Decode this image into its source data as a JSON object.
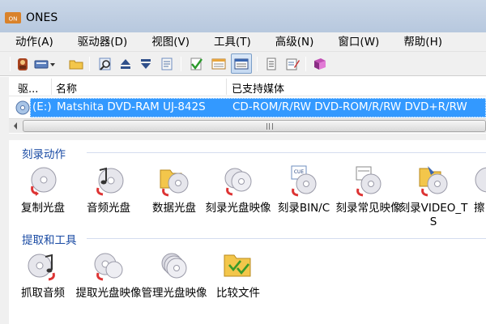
{
  "window": {
    "title": "ONES"
  },
  "menu": [
    {
      "label": "动作(A)"
    },
    {
      "label": "驱动器(D)"
    },
    {
      "label": "视图(V)"
    },
    {
      "label": "工具(T)"
    },
    {
      "label": "高级(N)"
    },
    {
      "label": "窗口(W)"
    },
    {
      "label": "帮助(H)"
    }
  ],
  "toolbar": {
    "icons": [
      "burner-icon",
      "dropdown-burn-icon",
      "open-folder-icon",
      "search-drive-icon",
      "eject-icon",
      "close-tray-icon",
      "drive-info-icon",
      "verify-icon",
      "details-view-icon",
      "list-view-icon",
      "log-icon",
      "edit-icon",
      "help-book-icon"
    ]
  },
  "drives": {
    "columns": [
      "驱...",
      "名称",
      "已支持媒体"
    ],
    "rows": [
      {
        "letter": "(E:)",
        "name": "Matshita DVD-RAM UJ-842S",
        "media": "CD-ROM/R/RW DVD-ROM/R/RW DVD+R/RW"
      }
    ]
  },
  "sections": [
    {
      "title": "刻录动作",
      "actions": [
        {
          "label": "复制光盘",
          "icon": "copy-disc-icon"
        },
        {
          "label": "音频光盘",
          "icon": "audio-disc-icon"
        },
        {
          "label": "数据光盘",
          "icon": "data-disc-icon"
        },
        {
          "label": "刻录光盘映像",
          "icon": "burn-image-icon"
        },
        {
          "label": "刻录BIN/C",
          "icon": "burn-bin-icon"
        },
        {
          "label": "刻录常见映像",
          "icon": "burn-common-image-icon"
        },
        {
          "label": "刻录VIDEO_TS",
          "icon": "burn-video-ts-icon"
        },
        {
          "label": "擦",
          "icon": "erase-disc-icon"
        }
      ]
    },
    {
      "title": "提取和工具",
      "actions": [
        {
          "label": "抓取音频",
          "icon": "rip-audio-icon"
        },
        {
          "label": "提取光盘映像",
          "icon": "extract-image-icon"
        },
        {
          "label": "管理光盘映像",
          "icon": "manage-images-icon"
        },
        {
          "label": "比较文件",
          "icon": "compare-files-icon"
        }
      ]
    }
  ],
  "colors": {
    "selection": "#3399ff",
    "section_title": "#1a4ba4",
    "titlebar": "#c9d6e7"
  }
}
